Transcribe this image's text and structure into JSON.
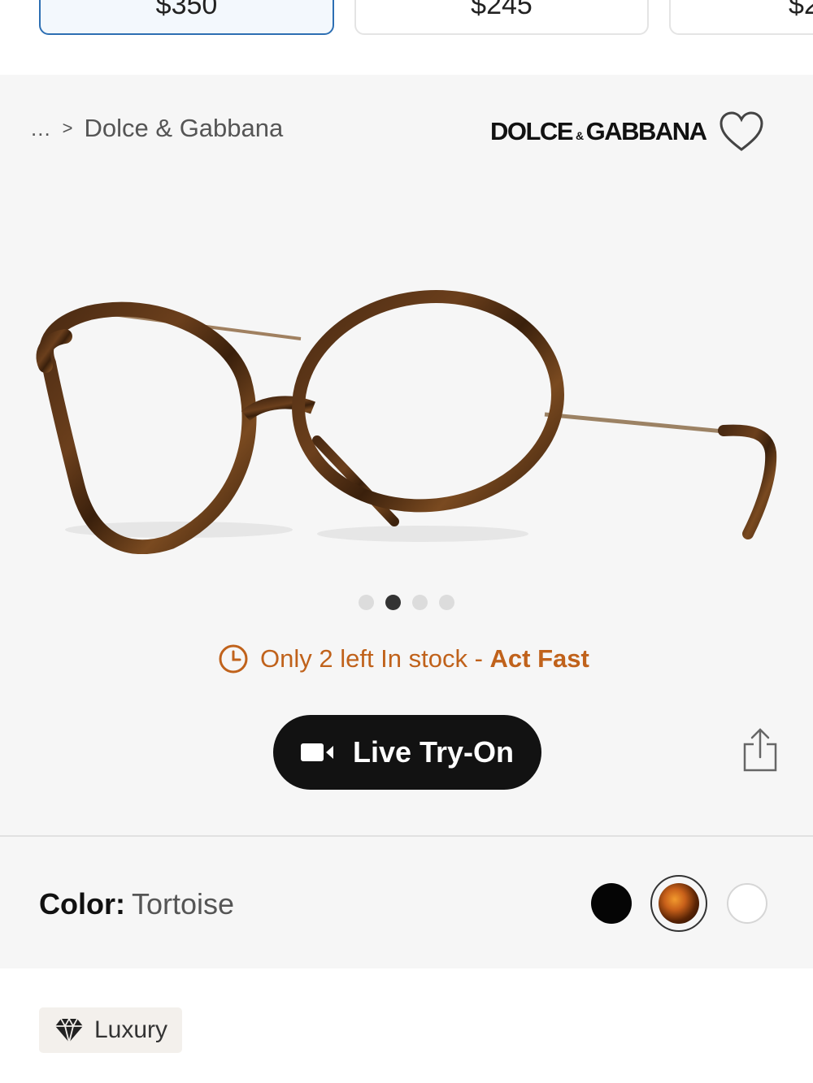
{
  "price_cards": [
    {
      "price": "$350",
      "selected": true
    },
    {
      "price": "$245",
      "selected": false
    },
    {
      "price": "$2",
      "selected": false
    }
  ],
  "breadcrumb": {
    "ellipsis": "...",
    "separator": ">",
    "current": "Dolce & Gabbana"
  },
  "brand": {
    "logo_left": "DOLCE",
    "logo_amp": "&",
    "logo_right": "GABBANA"
  },
  "icons": {
    "favorite": "heart-outline-icon",
    "clock": "clock-icon",
    "camera": "video-camera-icon",
    "share": "share-icon",
    "badge": "diamond-icon"
  },
  "carousel": {
    "count": 4,
    "active_index": 1
  },
  "stock": {
    "message": "Only 2 left In stock - ",
    "emphasis": "Act Fast"
  },
  "tryon": {
    "label": "Live Try-On"
  },
  "color": {
    "label": "Color:",
    "value": "Tortoise",
    "swatches": [
      "black",
      "tortoise",
      "white"
    ],
    "selected": "tortoise"
  },
  "badge": {
    "label": "Luxury"
  },
  "colors": {
    "stock_orange": "#c0621b",
    "selected_card_border": "#2d6fb3",
    "button_bg": "#121212",
    "panel_bg": "#f6f6f6"
  }
}
